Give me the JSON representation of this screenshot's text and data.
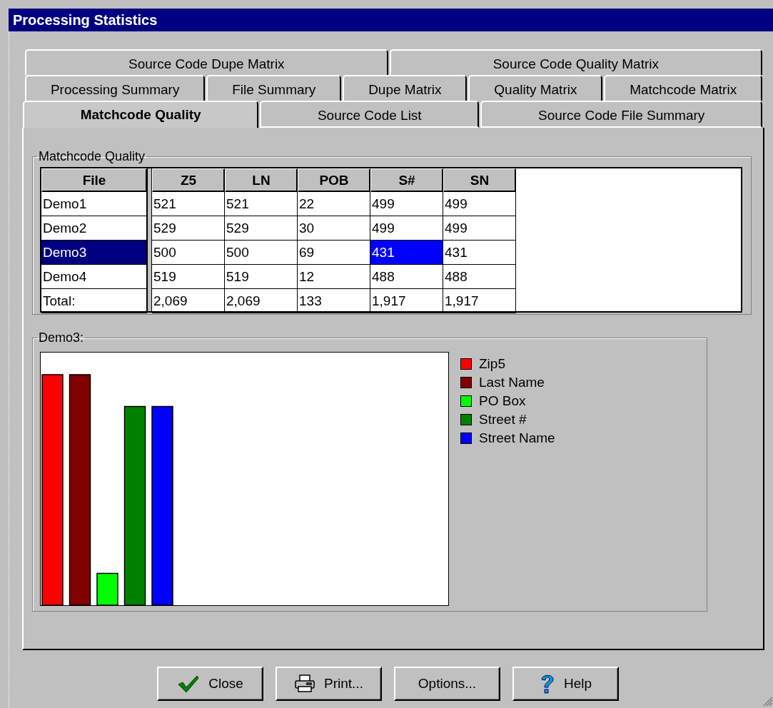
{
  "window": {
    "title": "Processing Statistics"
  },
  "tab_rows": [
    [
      {
        "label": "Source Code Dupe Matrix",
        "selected": false
      },
      {
        "label": "Source Code Quality Matrix",
        "selected": false
      }
    ],
    [
      {
        "label": "Processing Summary",
        "selected": false
      },
      {
        "label": "File Summary",
        "selected": false
      },
      {
        "label": "Dupe Matrix",
        "selected": false
      },
      {
        "label": "Quality Matrix",
        "selected": false
      },
      {
        "label": "Matchcode Matrix",
        "selected": false
      }
    ],
    [
      {
        "label": "Matchcode Quality",
        "selected": true
      },
      {
        "label": "Source Code List",
        "selected": false
      },
      {
        "label": "Source Code File Summary",
        "selected": false
      }
    ]
  ],
  "table": {
    "title": "Matchcode Quality",
    "columns": [
      "File",
      "Z5",
      "LN",
      "POB",
      "S#",
      "SN"
    ],
    "rows": [
      {
        "file": "Demo1",
        "selected": false,
        "cells": [
          {
            "value": "521",
            "selected": false
          },
          {
            "value": "521",
            "selected": false
          },
          {
            "value": "22",
            "selected": false
          },
          {
            "value": "499",
            "selected": false
          },
          {
            "value": "499",
            "selected": false
          }
        ]
      },
      {
        "file": "Demo2",
        "selected": false,
        "cells": [
          {
            "value": "529",
            "selected": false
          },
          {
            "value": "529",
            "selected": false
          },
          {
            "value": "30",
            "selected": false
          },
          {
            "value": "499",
            "selected": false
          },
          {
            "value": "499",
            "selected": false
          }
        ]
      },
      {
        "file": "Demo3",
        "selected": true,
        "cells": [
          {
            "value": "500",
            "selected": false
          },
          {
            "value": "500",
            "selected": false
          },
          {
            "value": "69",
            "selected": false
          },
          {
            "value": "431",
            "selected": true
          },
          {
            "value": "431",
            "selected": false
          }
        ]
      },
      {
        "file": "Demo4",
        "selected": false,
        "cells": [
          {
            "value": "519",
            "selected": false
          },
          {
            "value": "519",
            "selected": false
          },
          {
            "value": "12",
            "selected": false
          },
          {
            "value": "488",
            "selected": false
          },
          {
            "value": "488",
            "selected": false
          }
        ]
      },
      {
        "file": "Total:",
        "selected": false,
        "cells": [
          {
            "value": "2,069",
            "selected": false
          },
          {
            "value": "2,069",
            "selected": false
          },
          {
            "value": "133",
            "selected": false
          },
          {
            "value": "1,917",
            "selected": false
          },
          {
            "value": "1,917",
            "selected": false
          }
        ]
      }
    ]
  },
  "chart": {
    "title": "Demo3:",
    "legend": [
      {
        "label": "Zip5",
        "color": "#ff0000"
      },
      {
        "label": "Last Name",
        "color": "#800000"
      },
      {
        "label": "PO Box",
        "color": "#00ff00"
      },
      {
        "label": "Street #",
        "color": "#008000"
      },
      {
        "label": "Street Name",
        "color": "#0000ff"
      }
    ]
  },
  "buttons": [
    {
      "label": "Close",
      "kind": "check"
    },
    {
      "label": "Print...",
      "kind": "printer"
    },
    {
      "label": "Options...",
      "kind": "none"
    },
    {
      "label": "Help",
      "kind": "help"
    }
  ]
}
